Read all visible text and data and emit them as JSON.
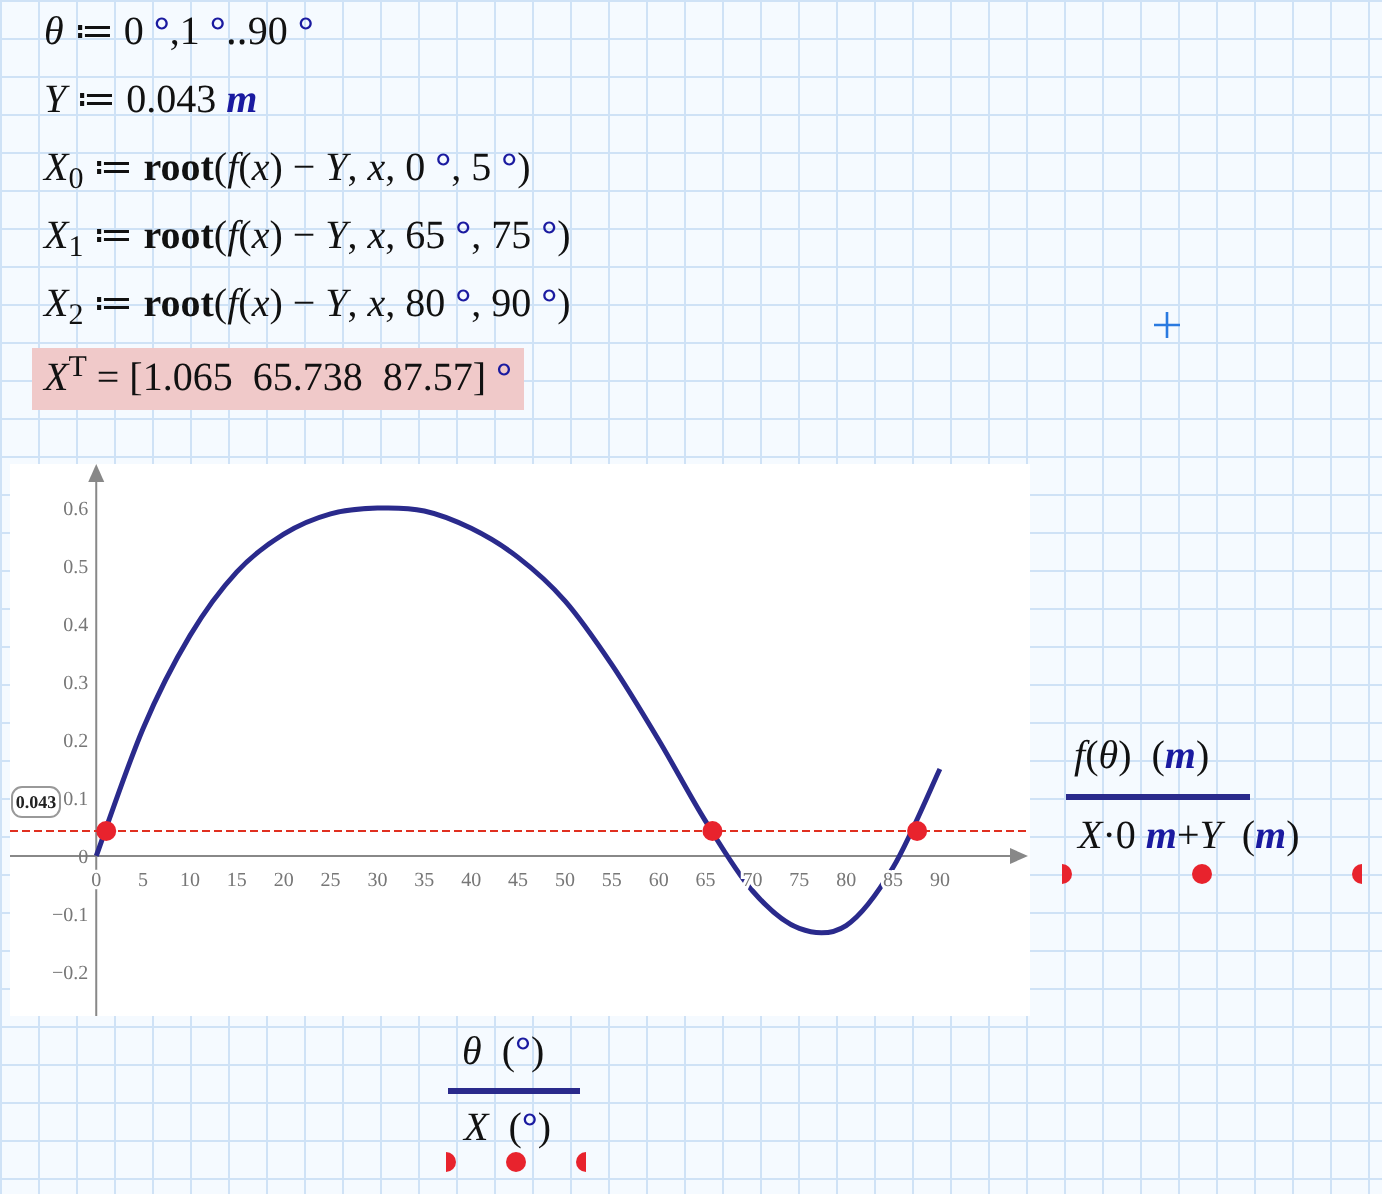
{
  "worksheet": {
    "lines": [
      [
        {
          "kind": "expr",
          "text": "*θ* ≔ 0 "
        },
        {
          "kind": "unit",
          "text": "°"
        },
        {
          "kind": "expr",
          "text": ",1 "
        },
        {
          "kind": "unit",
          "text": "°"
        },
        {
          "kind": "expr",
          "text": "‥90 "
        },
        {
          "kind": "unit",
          "text": "°"
        }
      ],
      [
        {
          "kind": "expr",
          "text": "*Y* ≔ 0.043 "
        },
        {
          "kind": "unit",
          "text": "*m*"
        }
      ],
      [
        {
          "kind": "expr",
          "text": "*X*$_{0}$ ≔ **root**(*f*(*x*) − *Y*, *x*, 0 "
        },
        {
          "kind": "unit",
          "text": "°"
        },
        {
          "kind": "expr",
          "text": ", 5 "
        },
        {
          "kind": "unit",
          "text": "°"
        },
        {
          "kind": "expr",
          "text": ")"
        }
      ],
      [
        {
          "kind": "expr",
          "text": "*X*$_{1}$ ≔ **root**(*f*(*x*) − *Y*, *x*, 65 "
        },
        {
          "kind": "unit",
          "text": "°"
        },
        {
          "kind": "expr",
          "text": ", 75 "
        },
        {
          "kind": "unit",
          "text": "°"
        },
        {
          "kind": "expr",
          "text": ")"
        }
      ],
      [
        {
          "kind": "expr",
          "text": "*X*$_{2}$ ≔ **root**(*f*(*x*) − *Y*, *x*, 80 "
        },
        {
          "kind": "unit",
          "text": "°"
        },
        {
          "kind": "expr",
          "text": ", 90 "
        },
        {
          "kind": "unit",
          "text": "°"
        },
        {
          "kind": "expr",
          "text": ")"
        }
      ]
    ],
    "result": [
      {
        "kind": "expr",
        "text": "*X*$^{T}$ = [1.065  65.738  87.57] "
      },
      {
        "kind": "unit",
        "text": "°"
      }
    ]
  },
  "plot": {
    "chart_data": {
      "type": "line",
      "x": [
        0,
        5,
        10,
        15,
        20,
        25,
        30,
        35,
        40,
        45,
        50,
        55,
        60,
        65,
        70,
        75,
        80,
        85,
        90
      ],
      "series": [
        {
          "color": "#2a2a8c",
          "values": [
            0,
            0.22,
            0.38,
            0.49,
            0.555,
            0.59,
            0.6,
            0.595,
            0.565,
            0.515,
            0.44,
            0.33,
            0.2,
            0.06,
            -0.06,
            -0.125,
            -0.12,
            -0.02,
            0.15
          ]
        },
        {
          "color": "#e03020",
          "line_style": "dashed",
          "x": [
            -9.2,
            99.4
          ],
          "values": [
            0.043,
            0.043
          ]
        },
        {
          "type": "scatter",
          "color": "#e8232d",
          "x": [
            1.065,
            65.738,
            87.57
          ],
          "values": [
            0.043,
            0.043,
            0.043
          ]
        }
      ],
      "xlim": [
        -9.2,
        99.4
      ],
      "ylim": [
        -0.276,
        0.676
      ],
      "xticks": [
        0,
        5,
        10,
        15,
        20,
        25,
        30,
        35,
        40,
        45,
        50,
        55,
        60,
        65,
        70,
        75,
        80,
        85,
        90
      ],
      "yticks": [
        -0.2,
        -0.1,
        0,
        0.1,
        0.2,
        0.3,
        0.4,
        0.5,
        0.6
      ],
      "annotations": [
        "0.043"
      ]
    },
    "y_axis_labels": [
      [
        {
          "kind": "expr",
          "text": "*f*(*θ*)  ("
        },
        {
          "kind": "unit",
          "text": "*m*"
        },
        {
          "kind": "expr",
          "text": ")"
        }
      ],
      [
        {
          "kind": "expr",
          "text": "*X*·0 "
        },
        {
          "kind": "unit",
          "text": "*m*"
        },
        {
          "kind": "expr",
          "text": "+*Y*  ("
        },
        {
          "kind": "unit",
          "text": "*m*"
        },
        {
          "kind": "expr",
          "text": ")"
        }
      ]
    ],
    "x_axis_labels": [
      [
        {
          "kind": "expr",
          "text": "*θ*  ("
        },
        {
          "kind": "unit",
          "text": "°"
        },
        {
          "kind": "expr",
          "text": ")"
        }
      ],
      [
        {
          "kind": "expr",
          "text": "*X*  ("
        },
        {
          "kind": "unit",
          "text": "°"
        },
        {
          "kind": "expr",
          "text": ")"
        }
      ]
    ]
  }
}
